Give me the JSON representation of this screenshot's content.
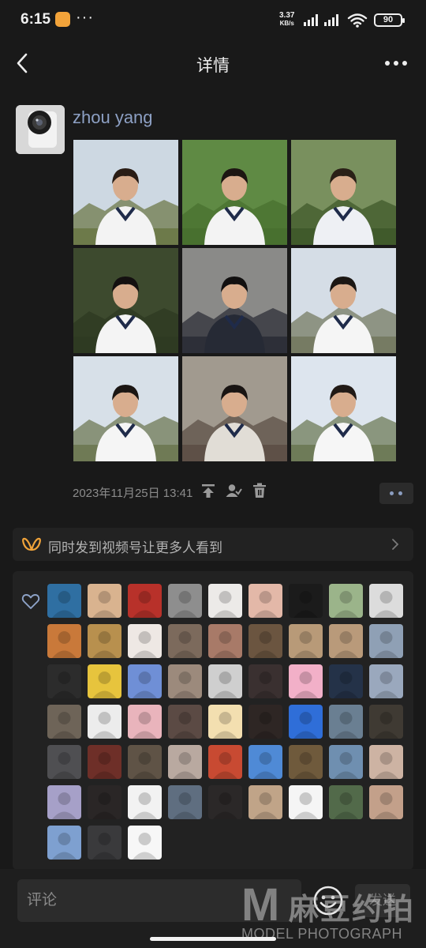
{
  "status_bar": {
    "time": "6:15",
    "more": "···",
    "speed_value": "3.37",
    "speed_unit": "KB/s",
    "battery": "90"
  },
  "nav": {
    "title": "详情"
  },
  "post": {
    "author": "zhou yang",
    "timestamp": "2023年11月25日 13:41",
    "photos": [
      {
        "sky": "#cdd8e2",
        "ground": "#6d7a4a",
        "shirt": "#f3f3f3",
        "hair": "#2a1d15"
      },
      {
        "sky": "#5f8a44",
        "ground": "#48702f",
        "shirt": "#f3f3f3",
        "hair": "#1d1612"
      },
      {
        "sky": "#79905e",
        "ground": "#405a2b",
        "shirt": "#eef0f4",
        "hair": "#2a2017"
      },
      {
        "sky": "#3d4a2e",
        "ground": "#2e3a22",
        "shirt": "#f4f4f4",
        "hair": "#141010"
      },
      {
        "sky": "#8a8a88",
        "ground": "#2d2f38",
        "shirt": "#262a35",
        "hair": "#121010"
      },
      {
        "sky": "#d5dde6",
        "ground": "#767b63",
        "shirt": "#f5f5f5",
        "hair": "#1c1714"
      },
      {
        "sky": "#d7e0e8",
        "ground": "#6f7a55",
        "shirt": "#f5f5f5",
        "hair": "#1b1613"
      },
      {
        "sky": "#a19a8f",
        "ground": "#5e5047",
        "shirt": "#e1ddd6",
        "hair": "#191412"
      },
      {
        "sky": "#dde5ee",
        "ground": "#6e7b58",
        "shirt": "#f6f6f6",
        "hair": "#211a16"
      }
    ]
  },
  "channel_bar": {
    "text": "同时发到视频号让更多人看到"
  },
  "likes": {
    "avatars": [
      "#2f6fa2",
      "#d9b38f",
      "#b8312a",
      "#8e8e8e",
      "#eceae8",
      "#e3b8a8",
      "#1b1b1b",
      "#9bb48a",
      "#dcdcdc",
      "#c9793a",
      "#b8904e",
      "#eee8e4",
      "#7c6a5c",
      "#a87a68",
      "#6b5540",
      "#b89a78",
      "#b99a7a",
      "#8fa0b5",
      "#2c2c2c",
      "#e7c43d",
      "#6f8fd6",
      "#9c8a7c",
      "#cfcfcf",
      "#3a3030",
      "#f2b0c8",
      "#243248",
      "#9aa8bd",
      "#6e6458",
      "#ececec",
      "#e9b4bc",
      "#5b4a44",
      "#f3dfb0",
      "#2e2624",
      "#2f6ed8",
      "#6a7f92",
      "#3f3a33",
      "#4f4f52",
      "#6e2f28",
      "#5f5346",
      "#b9a9a0",
      "#c84a32",
      "#4f8ad6",
      "#6f5a3c",
      "#6f8fb0",
      "#cdb3a3",
      "#a6a0c8",
      "#2a2626",
      "#f2f2f2",
      "#5f6e80",
      "#2b2828",
      "#c0a488",
      "#f5f5f5",
      "#526a4a",
      "#c3a08a",
      "#7ea0d0",
      "#3a3a3c",
      "#f7f7f7"
    ]
  },
  "comment": {
    "placeholder": "评论",
    "send": "发送"
  },
  "watermark": {
    "letter": "M",
    "cn": "麻豆约拍",
    "en": "MODEL PHOTOGRAPH"
  }
}
